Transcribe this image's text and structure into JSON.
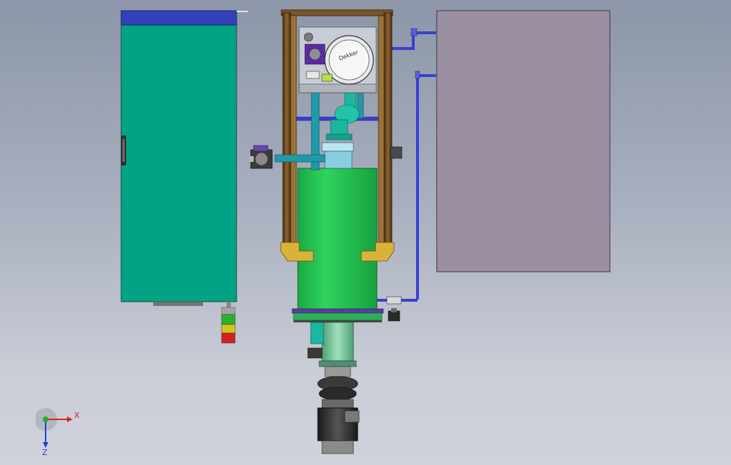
{
  "viewport": {
    "background_top": "#8c96a8",
    "background_bottom": "#cfd2da"
  },
  "scene": {
    "cabinet_color": "#00a383",
    "cabinet_top_color": "#3440b8",
    "tank_color": "#22cc55",
    "frame_color": "#6b4a25",
    "pipe_color": "#3b3fd0",
    "panel_right_color": "#9b8fa2",
    "pump_brand_text": "Dekker"
  },
  "triad": {
    "x_label": "X",
    "z_label": "Z",
    "x_color": "#e02020",
    "y_color": "#20b020",
    "z_color": "#2040e0"
  }
}
